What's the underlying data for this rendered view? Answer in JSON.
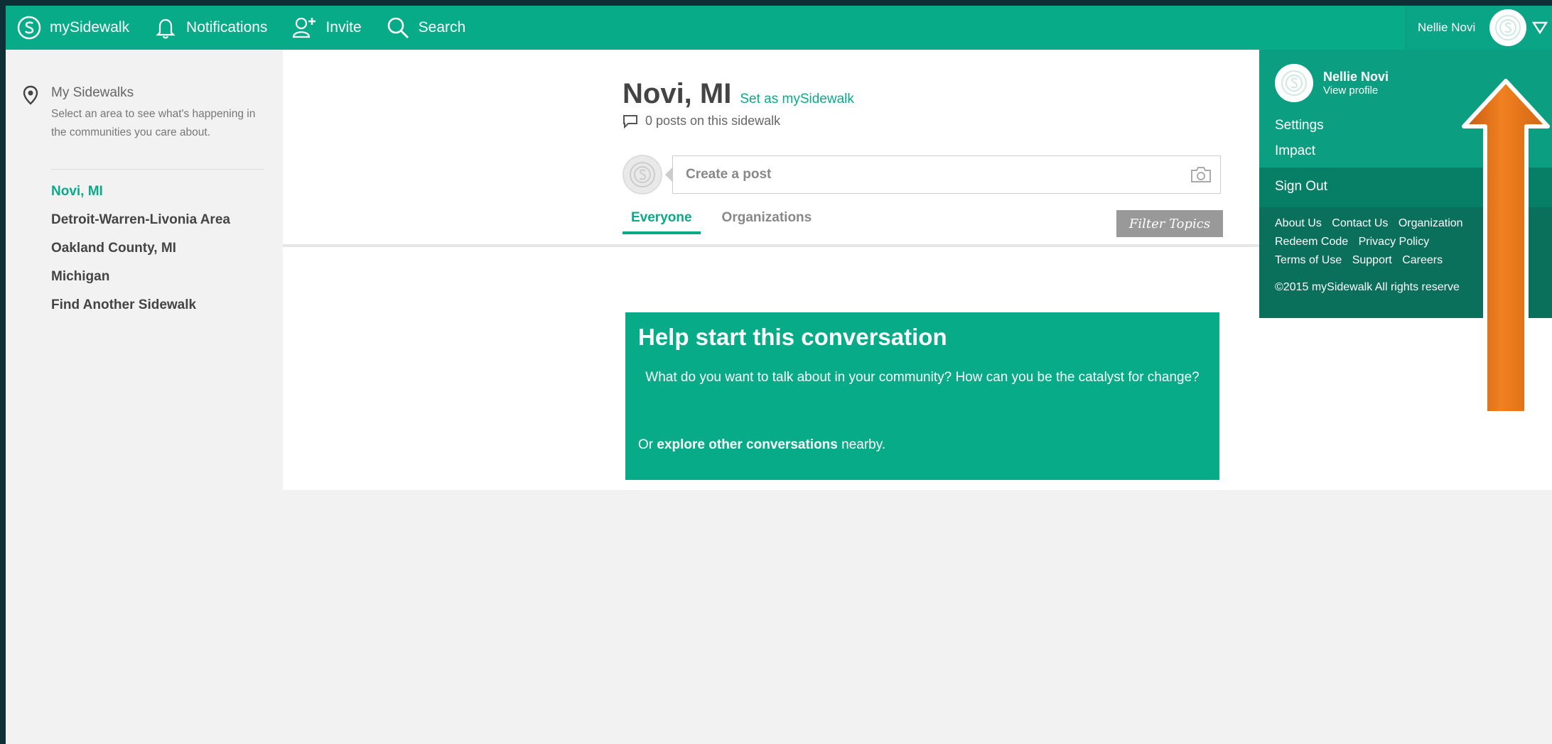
{
  "topbar": {
    "logo_label": "mySidewalk",
    "notifications_label": "Notifications",
    "invite_label": "Invite",
    "search_label": "Search",
    "user_name": "Nellie Novi",
    "brand_color": "#07ab87"
  },
  "sidebar": {
    "title": "My Sidewalks",
    "description": "Select an area to see what's happening in the communities you care about.",
    "items": [
      {
        "label": "Novi, MI",
        "active": true
      },
      {
        "label": "Detroit-Warren-Livonia Area"
      },
      {
        "label": "Oakland County, MI"
      },
      {
        "label": "Michigan"
      },
      {
        "label": "Find Another Sidewalk"
      }
    ]
  },
  "main": {
    "title": "Novi, MI",
    "set_link": "Set as mySidewalk",
    "posts_count": "0 posts on this sidewalk",
    "composer_placeholder": "Create a post",
    "tabs": [
      {
        "label": "Everyone",
        "active": true
      },
      {
        "label": "Organizations"
      }
    ],
    "filter_label": "Filter Topics",
    "empty": {
      "title": "Help start this conversation",
      "text": "What do you want to talk about in your community? How can you be the catalyst for change?",
      "explore_prefix": "Or",
      "explore_link": "explore other conversations",
      "explore_suffix": "nearby."
    }
  },
  "dropdown": {
    "name": "Nellie Novi",
    "view_profile": "View profile",
    "settings": "Settings",
    "impact": "Impact",
    "sign_out": "Sign Out",
    "footer_row1": [
      "About Us",
      "Contact Us",
      "Organization"
    ],
    "footer_row2": [
      "Redeem Code",
      "Privacy Policy"
    ],
    "footer_row3": [
      "Terms of Use",
      "Support",
      "Careers"
    ],
    "copyright": "©2015 mySidewalk All rights reserve"
  }
}
